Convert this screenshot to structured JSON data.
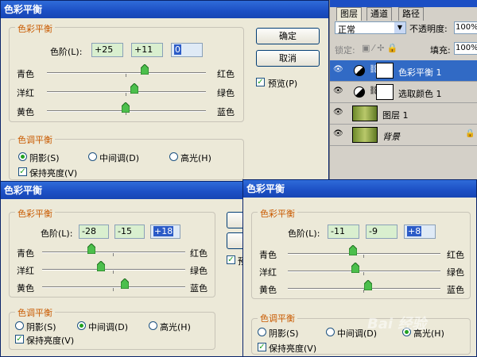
{
  "window1": {
    "title": "色彩平衡",
    "color_balance_legend": "色彩平衡",
    "levels_label": "色阶(L):",
    "levels": [
      "+25",
      "+11",
      "0"
    ],
    "cyan": "青色",
    "red": "红色",
    "magenta": "洋红",
    "green": "绿色",
    "yellow": "黄色",
    "blue": "蓝色",
    "tone_legend": "色调平衡",
    "shadows": "阴影(S)",
    "midtones": "中间调(D)",
    "highlights": "高光(H)",
    "preserve": "保持亮度(V)",
    "ok": "确定",
    "cancel": "取消",
    "preview": "预览(P)"
  },
  "layers_panel": {
    "tabs": [
      "图层",
      "通道",
      "路径"
    ],
    "blend_mode": "正常",
    "opacity_label": "不透明度:",
    "opacity_value": "100%",
    "lock_label": "锁定:",
    "fill_label": "填充:",
    "fill_value": "100%",
    "layers": [
      {
        "name": "色彩平衡 1"
      },
      {
        "name": "选取颜色 1"
      },
      {
        "name": "图层 1"
      },
      {
        "name": "背景"
      }
    ]
  },
  "window2": {
    "title": "色彩平衡",
    "color_balance_legend": "色彩平衡",
    "levels_label": "色阶(L):",
    "levels": [
      "-28",
      "-15",
      "+18"
    ],
    "cyan": "青色",
    "red": "红色",
    "magenta": "洋红",
    "green": "绿色",
    "yellow": "黄色",
    "blue": "蓝色",
    "tone_legend": "色调平衡",
    "shadows": "阴影(S)",
    "midtones": "中间调(D)",
    "highlights": "高光(H)",
    "preserve": "保持亮度(V)",
    "preview_fragment": "预"
  },
  "window3": {
    "title": "色彩平衡",
    "color_balance_legend": "色彩平衡",
    "levels_label": "色阶(L):",
    "levels": [
      "-11",
      "-9",
      "+8"
    ],
    "cyan": "青色",
    "red": "红色",
    "magenta": "洋红",
    "green": "绿色",
    "yellow": "黄色",
    "blue": "蓝色",
    "tone_legend": "色调平衡",
    "shadows": "阴影(S)",
    "midtones": "中间调(D)",
    "highlights": "高光(H)",
    "preserve": "保持亮度(V)"
  },
  "watermark": "Bai 经验",
  "colors": {
    "legend": "#c95a00",
    "titlebar": "#1c4fc4",
    "field": "#d9efcf",
    "selected_layer": "#316ac5"
  }
}
